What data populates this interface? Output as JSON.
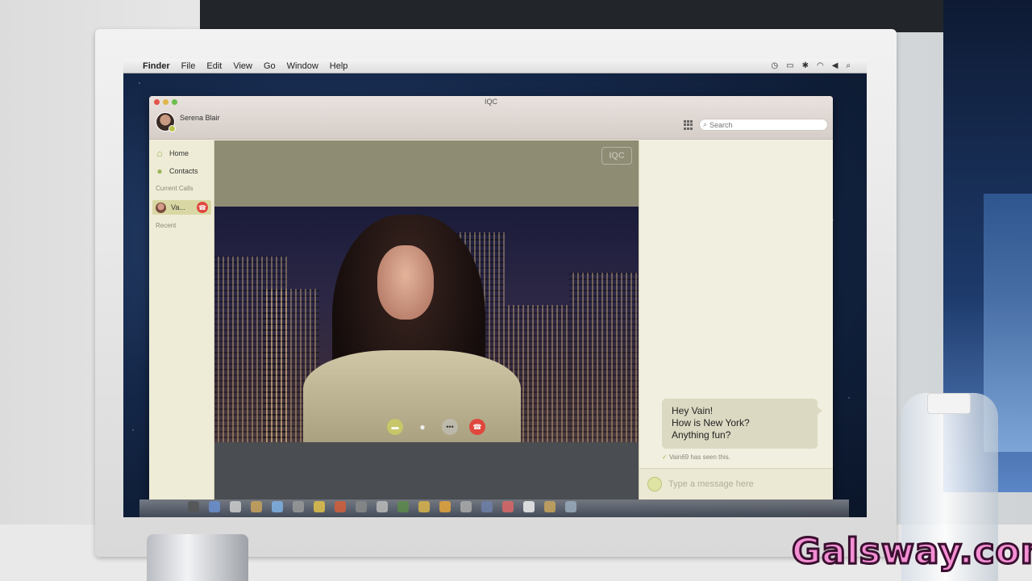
{
  "menubar": {
    "app_name": "Finder",
    "items": [
      "File",
      "Edit",
      "View",
      "Go",
      "Window",
      "Help"
    ]
  },
  "window": {
    "title": "IQC",
    "user_name": "Serena Blair",
    "search_placeholder": "Search"
  },
  "sidebar": {
    "home_label": "Home",
    "contacts_label": "Contacts",
    "current_calls_label": "Current Calls",
    "active_call_name": "Va...",
    "recent_label": "Recent"
  },
  "video": {
    "logo_text": "IQC"
  },
  "chat": {
    "message_lines": [
      "Hey Vain!",
      "How is New York?",
      "Anything fun?"
    ],
    "seen_text": "Vain69 has seen this.",
    "composer_placeholder": "Type a message here"
  },
  "overlay": {
    "watermark": "Galsway.com"
  },
  "colors": {
    "accent": "#9cb45a",
    "hangup": "#e0473d",
    "sidebar_bg": "#eeecd6",
    "active_row": "#d9d8a4"
  }
}
